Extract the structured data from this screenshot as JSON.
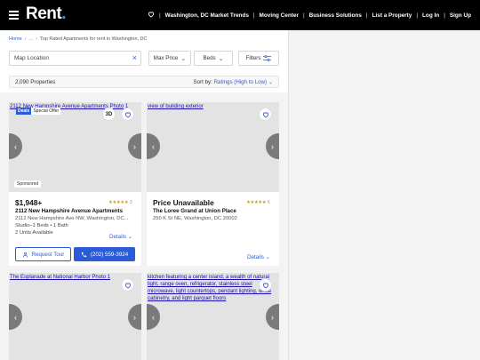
{
  "header": {
    "logo": "Rent",
    "logo_dot": ".",
    "nav": [
      "Washington, DC Market Trends",
      "Moving Center",
      "Business Solutions",
      "List a Property",
      "Log In",
      "Sign Up"
    ]
  },
  "breadcrumb": {
    "home": "Home",
    "ellipsis": "...",
    "current": "Top Rated Apartments for rent in Washington, DC"
  },
  "search": {
    "placeholder": "Map Location"
  },
  "filters": {
    "max_price": "Max Price",
    "beds": "Beds",
    "filters": "Filters"
  },
  "results": {
    "count": "2,090 Properties",
    "sort_label": "Sort by:",
    "sort_value": "Ratings (High to Low)"
  },
  "listings": [
    {
      "photo_alt": "2112 New Hampshire Avenue Apartments Photo 1",
      "deals_badge": "Deals",
      "special_badge": "Special Offer",
      "view3d": "3D",
      "sponsored": "Sponsored",
      "price": "$1,948+",
      "name": "2112 New Hampshire Avenue Apartments",
      "address": "2112 New Hampshire Ave NW, Washington, DC...",
      "beds_baths": "Studio–1 Beds • 1 Bath",
      "availability": "2 Units Available",
      "rating_count": "3",
      "rating_stars": "★★★★★",
      "details": "Details",
      "tour": "Request Tour",
      "phone": "(202) 559-3924"
    },
    {
      "photo_alt": "view of building exterior",
      "price": "Price Unavailable",
      "name": "The Loree Grand at Union Place",
      "address": "250 K St NE, Washington, DC 20002",
      "rating_count": "6",
      "rating_stars": "★★★★★",
      "details": "Details"
    },
    {
      "photo_alt": "The Esplanade at National Harbor Photo 1"
    },
    {
      "photo_alt": "kitchen featuring a center island, a wealth of natural light, range oven, refrigerator, stainless steel microwave, light countertops, pendant lighting, white cabinetry, and light parquet floors"
    }
  ],
  "colors": {
    "accent": "#2b5bd7",
    "topbar": "#000000",
    "stars": "#c8a13a"
  }
}
